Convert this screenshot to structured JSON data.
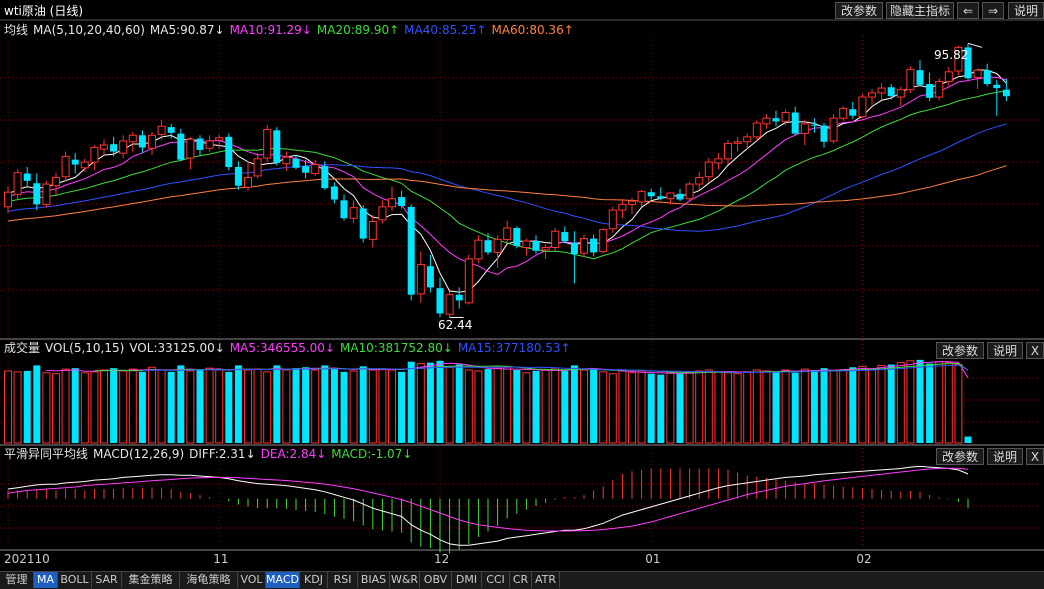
{
  "header": {
    "title": "wti原油 (日线)",
    "buttons": [
      "改参数",
      "隐藏主指标",
      "⇐",
      "⇒",
      "说明"
    ]
  },
  "main_panel": {
    "legend": [
      {
        "text": "均线",
        "color": "#e6e6e6"
      },
      {
        "text": "MA(5,10,20,40,60)",
        "color": "#e6e6e6"
      },
      {
        "text": "MA5:90.87↓",
        "color": "#e6e6e6"
      },
      {
        "text": "MA10:91.29↓",
        "color": "#ff3cff"
      },
      {
        "text": "MA20:89.90↑",
        "color": "#3ddc3d"
      },
      {
        "text": "MA40:85.25↑",
        "color": "#3050ff"
      },
      {
        "text": "MA60:80.36↑",
        "color": "#ff8040"
      }
    ],
    "high_label": "95.82",
    "low_label": "62.44"
  },
  "volume_panel": {
    "legend": [
      {
        "text": "成交量",
        "color": "#e6e6e6"
      },
      {
        "text": "VOL(5,10,15)",
        "color": "#e6e6e6"
      },
      {
        "text": "VOL:33125.00↓",
        "color": "#e6e6e6"
      },
      {
        "text": "MA5:346555.00↓",
        "color": "#ff3cff"
      },
      {
        "text": "MA10:381752.80↓",
        "color": "#3ddc3d"
      },
      {
        "text": "MA15:377180.53↑",
        "color": "#3050ff"
      }
    ],
    "buttons": [
      "改参数",
      "说明",
      "X"
    ]
  },
  "macd_panel": {
    "legend": [
      {
        "text": "平滑异同平均线",
        "color": "#e6e6e6"
      },
      {
        "text": "MACD(12,26,9)",
        "color": "#e6e6e6"
      },
      {
        "text": "DIFF:2.31↓",
        "color": "#e6e6e6"
      },
      {
        "text": "DEA:2.84↓",
        "color": "#ff3cff"
      },
      {
        "text": "MACD:-1.07↓",
        "color": "#3ddc3d"
      }
    ],
    "buttons": [
      "改参数",
      "说明",
      "X"
    ]
  },
  "x_axis": {
    "labels": [
      {
        "text": "202110",
        "index": 0
      },
      {
        "text": "11",
        "index": 22
      },
      {
        "text": "12",
        "index": 45
      },
      {
        "text": "01",
        "index": 67
      },
      {
        "text": "02",
        "index": 89
      }
    ]
  },
  "tabs": [
    "管理",
    "MA",
    "BOLL",
    "SAR",
    "集金策略",
    "海龟策略",
    "VOL",
    "MACD",
    "KDJ",
    "RSI",
    "BIAS",
    "W&R",
    "OBV",
    "DMI",
    "CCI",
    "CR",
    "ATR"
  ],
  "active_tabs": [
    "MA",
    "MACD"
  ],
  "colors": {
    "up": "#ff3232",
    "down": "#00e5ff",
    "ma5": "#ffffff",
    "ma10": "#ff3cff",
    "ma20": "#3ddc3d",
    "ma40": "#3050ff",
    "ma60": "#ff8040",
    "grid": "#7a0000"
  },
  "chart_data": {
    "type": "candlestick",
    "price_range": [
      60,
      97
    ],
    "ohlc": [
      [
        76.0,
        78.5,
        75.2,
        77.8
      ],
      [
        77.5,
        80.6,
        76.8,
        80.2
      ],
      [
        80.1,
        80.9,
        78.6,
        79.2
      ],
      [
        78.9,
        80.1,
        75.6,
        76.3
      ],
      [
        76.3,
        79.2,
        75.9,
        78.8
      ],
      [
        78.6,
        80.2,
        77.5,
        79.6
      ],
      [
        79.7,
        82.8,
        79.1,
        82.2
      ],
      [
        81.8,
        82.6,
        80.1,
        81.2
      ],
      [
        80.8,
        81.9,
        80.3,
        81.5
      ],
      [
        81.5,
        83.6,
        80.5,
        83.3
      ],
      [
        83.1,
        84.3,
        82.5,
        83.6
      ],
      [
        83.7,
        84.6,
        82.2,
        82.8
      ],
      [
        82.6,
        84.8,
        82.0,
        84.1
      ],
      [
        84.0,
        85.2,
        82.7,
        84.8
      ],
      [
        84.8,
        85.4,
        82.6,
        83.3
      ],
      [
        83.2,
        85.2,
        82.4,
        84.8
      ],
      [
        84.9,
        86.7,
        84.2,
        85.9
      ],
      [
        85.8,
        86.2,
        84.4,
        85.1
      ],
      [
        85.0,
        85.6,
        81.6,
        81.8
      ],
      [
        82.0,
        84.6,
        80.6,
        84.3
      ],
      [
        84.4,
        84.8,
        82.3,
        83.0
      ],
      [
        83.2,
        84.8,
        82.8,
        84.1
      ],
      [
        84.2,
        84.9,
        83.1,
        84.5
      ],
      [
        84.6,
        85.0,
        80.5,
        80.9
      ],
      [
        80.9,
        81.6,
        78.1,
        78.6
      ],
      [
        78.4,
        81.6,
        78.0,
        79.6
      ],
      [
        79.8,
        82.6,
        79.5,
        81.9
      ],
      [
        82.0,
        86.1,
        81.5,
        85.5
      ],
      [
        85.4,
        85.8,
        81.1,
        81.4
      ],
      [
        81.3,
        82.8,
        80.4,
        82.1
      ],
      [
        81.9,
        82.4,
        80.6,
        80.8
      ],
      [
        81.0,
        81.8,
        79.5,
        80.2
      ],
      [
        80.1,
        81.8,
        79.8,
        81.2
      ],
      [
        81.0,
        81.6,
        78.1,
        78.3
      ],
      [
        78.5,
        79.0,
        76.4,
        76.9
      ],
      [
        76.8,
        77.5,
        74.3,
        74.6
      ],
      [
        74.6,
        76.8,
        74.0,
        75.9
      ],
      [
        75.8,
        76.2,
        71.6,
        72.1
      ],
      [
        72.0,
        75.0,
        71.0,
        74.2
      ],
      [
        74.4,
        76.8,
        74.0,
        76.0
      ],
      [
        76.0,
        78.5,
        75.5,
        77.0
      ],
      [
        77.2,
        78.0,
        75.8,
        76.1
      ],
      [
        76.0,
        76.3,
        64.5,
        65.2
      ],
      [
        65.3,
        70.5,
        64.2,
        68.9
      ],
      [
        68.7,
        70.1,
        65.5,
        66.1
      ],
      [
        66.0,
        67.3,
        62.44,
        62.9
      ],
      [
        62.8,
        65.6,
        62.4,
        65.2
      ],
      [
        65.2,
        66.1,
        63.5,
        64.5
      ],
      [
        64.2,
        70.1,
        64.0,
        69.6
      ],
      [
        69.6,
        72.5,
        69.1,
        71.9
      ],
      [
        71.9,
        72.8,
        70.1,
        70.4
      ],
      [
        70.4,
        72.5,
        68.5,
        72.0
      ],
      [
        72.0,
        74.3,
        71.5,
        73.4
      ],
      [
        73.4,
        73.6,
        70.9,
        71.2
      ],
      [
        71.0,
        72.1,
        70.0,
        71.8
      ],
      [
        71.8,
        72.5,
        70.2,
        70.6
      ],
      [
        70.7,
        71.4,
        69.6,
        71.0
      ],
      [
        71.0,
        73.4,
        70.5,
        73.0
      ],
      [
        72.9,
        73.6,
        71.5,
        71.8
      ],
      [
        71.6,
        73.0,
        66.6,
        70.2
      ],
      [
        70.3,
        72.6,
        69.8,
        72.1
      ],
      [
        72.1,
        72.6,
        69.9,
        70.4
      ],
      [
        70.5,
        73.4,
        70.3,
        73.2
      ],
      [
        73.3,
        76.0,
        72.8,
        75.6
      ],
      [
        75.6,
        77.0,
        74.6,
        76.3
      ],
      [
        76.3,
        77.1,
        75.1,
        76.7
      ],
      [
        76.6,
        78.1,
        76.1,
        77.9
      ],
      [
        77.8,
        78.2,
        76.9,
        77.3
      ],
      [
        77.3,
        78.4,
        76.8,
        77.0
      ],
      [
        77.0,
        77.8,
        76.3,
        77.7
      ],
      [
        77.6,
        78.2,
        76.7,
        76.9
      ],
      [
        77.0,
        79.1,
        76.6,
        78.8
      ],
      [
        78.8,
        80.3,
        78.1,
        79.6
      ],
      [
        79.7,
        82.0,
        79.1,
        81.5
      ],
      [
        81.4,
        82.6,
        80.6,
        81.9
      ],
      [
        81.9,
        84.2,
        81.2,
        83.8
      ],
      [
        83.8,
        84.6,
        82.8,
        84.0
      ],
      [
        84.0,
        85.0,
        83.1,
        84.6
      ],
      [
        84.6,
        86.6,
        84.1,
        86.3
      ],
      [
        86.2,
        87.4,
        85.6,
        86.9
      ],
      [
        86.9,
        87.8,
        85.9,
        86.5
      ],
      [
        86.5,
        88.0,
        86.0,
        87.6
      ],
      [
        87.6,
        88.3,
        84.8,
        85.0
      ],
      [
        85.0,
        86.7,
        83.6,
        86.2
      ],
      [
        86.1,
        86.9,
        85.1,
        86.0
      ],
      [
        86.0,
        86.3,
        83.3,
        84.0
      ],
      [
        84.1,
        87.4,
        83.8,
        86.9
      ],
      [
        86.9,
        88.4,
        86.6,
        88.1
      ],
      [
        88.0,
        88.9,
        86.8,
        87.2
      ],
      [
        87.1,
        89.9,
        86.9,
        89.5
      ],
      [
        89.5,
        90.5,
        88.5,
        90.0
      ],
      [
        90.0,
        91.2,
        89.1,
        90.6
      ],
      [
        90.7,
        91.1,
        89.2,
        89.6
      ],
      [
        89.5,
        90.8,
        88.4,
        90.4
      ],
      [
        90.4,
        93.3,
        90.0,
        92.9
      ],
      [
        92.8,
        94.0,
        90.8,
        91.0
      ],
      [
        91.1,
        92.5,
        89.0,
        89.4
      ],
      [
        89.5,
        91.8,
        89.1,
        91.4
      ],
      [
        91.4,
        93.2,
        90.8,
        92.6
      ],
      [
        92.7,
        95.82,
        92.2,
        95.6
      ],
      [
        95.6,
        96.1,
        91.6,
        91.8
      ],
      [
        91.9,
        93.0,
        90.5,
        92.8
      ],
      [
        92.8,
        93.6,
        90.8,
        91.1
      ],
      [
        91.0,
        91.6,
        87.2,
        90.6
      ],
      [
        90.4,
        91.8,
        89.0,
        89.6
      ]
    ],
    "volume": [
      390,
      385,
      390,
      420,
      380,
      375,
      400,
      405,
      380,
      385,
      395,
      405,
      390,
      400,
      385,
      410,
      395,
      385,
      420,
      390,
      395,
      405,
      395,
      385,
      420,
      395,
      400,
      385,
      420,
      395,
      405,
      410,
      395,
      420,
      400,
      385,
      390,
      415,
      395,
      400,
      395,
      385,
      440,
      430,
      435,
      445,
      410,
      425,
      395,
      390,
      400,
      405,
      410,
      395,
      380,
      390,
      395,
      405,
      390,
      420,
      395,
      405,
      385,
      375,
      390,
      380,
      385,
      375,
      370,
      380,
      375,
      385,
      390,
      395,
      385,
      380,
      375,
      385,
      395,
      390,
      385,
      395,
      380,
      400,
      395,
      405,
      390,
      395,
      410,
      415,
      400,
      420,
      425,
      435,
      445,
      450,
      430,
      440,
      435,
      425,
      35
    ],
    "diff": [
      0.7,
      0.8,
      0.9,
      1.0,
      1.05,
      1.05,
      1.15,
      1.2,
      1.25,
      1.35,
      1.4,
      1.45,
      1.55,
      1.6,
      1.65,
      1.7,
      1.75,
      1.75,
      1.7,
      1.7,
      1.65,
      1.6,
      1.55,
      1.45,
      1.3,
      1.2,
      1.1,
      1.05,
      1.0,
      0.95,
      0.85,
      0.75,
      0.65,
      0.5,
      0.3,
      0.1,
      -0.1,
      -0.4,
      -0.7,
      -0.9,
      -1.1,
      -1.3,
      -1.9,
      -2.3,
      -2.6,
      -3.0,
      -3.3,
      -3.4,
      -3.4,
      -3.3,
      -3.2,
      -3.1,
      -2.9,
      -2.8,
      -2.7,
      -2.6,
      -2.5,
      -2.4,
      -2.3,
      -2.3,
      -2.2,
      -2.0,
      -1.8,
      -1.5,
      -1.2,
      -1.0,
      -0.8,
      -0.6,
      -0.4,
      -0.2,
      0.0,
      0.2,
      0.4,
      0.6,
      0.8,
      0.95,
      1.05,
      1.15,
      1.25,
      1.35,
      1.45,
      1.55,
      1.6,
      1.65,
      1.75,
      1.8,
      1.85,
      1.9,
      1.95,
      2.0,
      2.05,
      2.1,
      2.15,
      2.2,
      2.3,
      2.35,
      2.3,
      2.25,
      2.2,
      2.1,
      1.8
    ],
    "dea": [
      0.4,
      0.5,
      0.6,
      0.65,
      0.7,
      0.75,
      0.8,
      0.85,
      0.95,
      1.0,
      1.05,
      1.1,
      1.15,
      1.2,
      1.25,
      1.3,
      1.35,
      1.4,
      1.45,
      1.5,
      1.52,
      1.54,
      1.55,
      1.55,
      1.52,
      1.48,
      1.44,
      1.4,
      1.36,
      1.32,
      1.26,
      1.2,
      1.14,
      1.06,
      0.96,
      0.84,
      0.72,
      0.58,
      0.42,
      0.26,
      0.1,
      -0.06,
      -0.3,
      -0.55,
      -0.8,
      -1.05,
      -1.3,
      -1.55,
      -1.75,
      -1.9,
      -2.0,
      -2.1,
      -2.18,
      -2.25,
      -2.3,
      -2.33,
      -2.35,
      -2.36,
      -2.36,
      -2.35,
      -2.33,
      -2.3,
      -2.25,
      -2.18,
      -2.1,
      -2.0,
      -1.85,
      -1.7,
      -1.5,
      -1.3,
      -1.1,
      -0.9,
      -0.7,
      -0.5,
      -0.3,
      -0.1,
      0.1,
      0.3,
      0.45,
      0.6,
      0.75,
      0.9,
      1.0,
      1.1,
      1.2,
      1.3,
      1.38,
      1.46,
      1.54,
      1.62,
      1.7,
      1.78,
      1.86,
      1.94,
      2.02,
      2.1,
      2.16,
      2.2,
      2.22,
      2.22,
      2.15
    ]
  }
}
